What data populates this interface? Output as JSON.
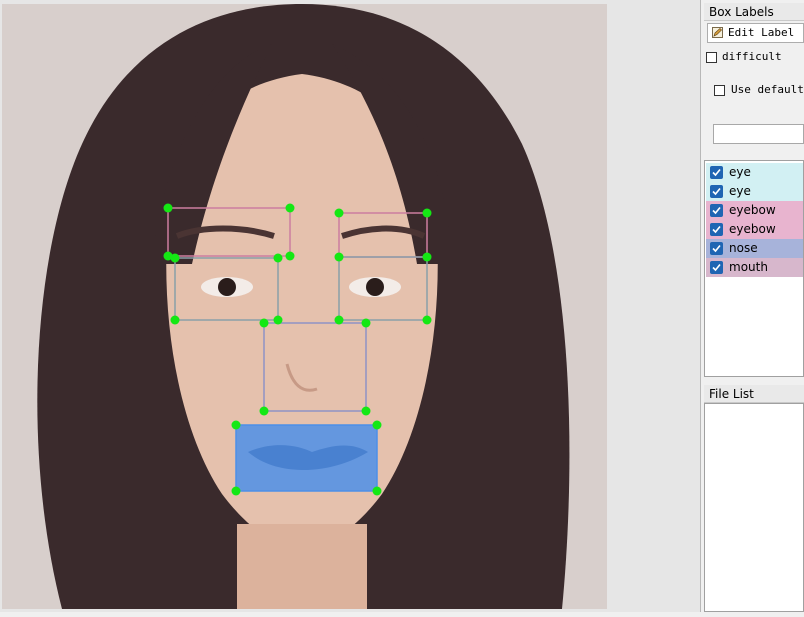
{
  "box_labels_panel": {
    "title": "Box Labels",
    "edit_label_button": "Edit Label",
    "difficult_label": "difficult",
    "use_default_label": "Use default l",
    "default_label_value": ""
  },
  "labels": [
    {
      "text": "eye",
      "checked": true,
      "color": "#d2f0f3"
    },
    {
      "text": "eye",
      "checked": true,
      "color": "#d2f0f3"
    },
    {
      "text": "eyebow",
      "checked": true,
      "color": "#e8b4cf"
    },
    {
      "text": "eyebow",
      "checked": true,
      "color": "#e8b4cf"
    },
    {
      "text": "nose",
      "checked": true,
      "color": "#a7b3da"
    },
    {
      "text": "mouth",
      "checked": true,
      "color": "#d7b7cc"
    }
  ],
  "file_list_panel": {
    "title": "File List"
  },
  "colors": {
    "vertex": "#14e814",
    "eye_box": "#8a9fa8",
    "eyebrow_box": "#cc7ea0",
    "nose_box": "#8f93c5",
    "mouth_fill": "#4d8fe8",
    "checkbox_checked": "#1f65b3"
  }
}
